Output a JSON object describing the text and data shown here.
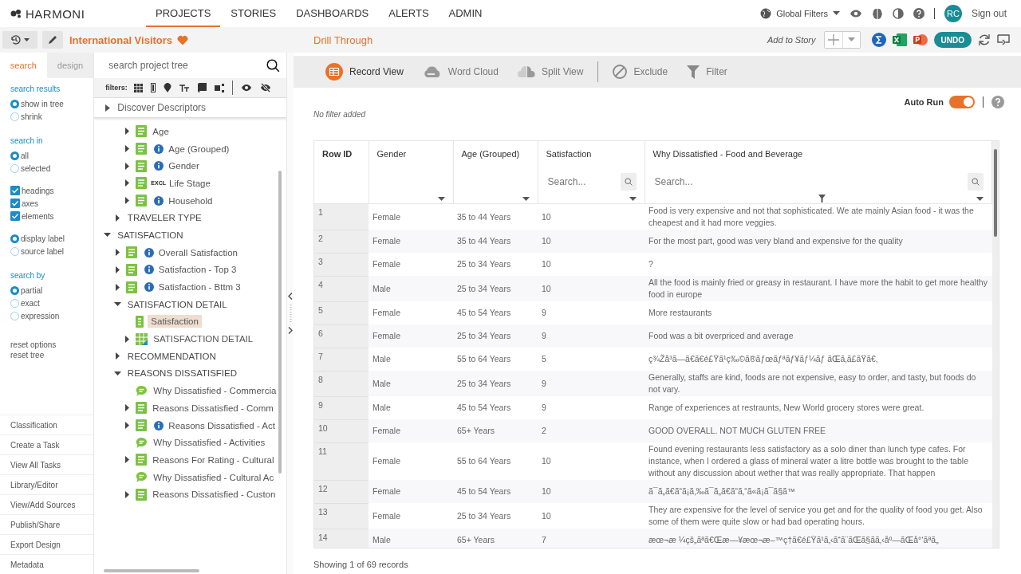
{
  "brand": "HARMONI",
  "nav": [
    {
      "label": "PROJECTS",
      "selected": true
    },
    {
      "label": "STORIES",
      "selected": false
    },
    {
      "label": "DASHBOARDS",
      "selected": false
    },
    {
      "label": "ALERTS",
      "selected": false
    },
    {
      "label": "ADMIN",
      "selected": false
    }
  ],
  "global_filters": "Global Filters",
  "avatar": "RC",
  "sign_out": "Sign out",
  "project_title": "International Visitors",
  "left_tabs": [
    {
      "label": "search",
      "selected": true
    },
    {
      "label": "design",
      "selected": false
    }
  ],
  "tree_search": {
    "placeholder": "search project tree"
  },
  "filters_label": "filters:",
  "options": [
    {
      "kind": "heading",
      "label": "search results"
    },
    {
      "kind": "radio",
      "items": [
        {
          "label": "show in tree",
          "selected": true
        },
        {
          "label": "shrink",
          "selected": false
        }
      ]
    },
    {
      "kind": "heading",
      "label": "search in"
    },
    {
      "kind": "radio",
      "items": [
        {
          "label": "all",
          "selected": true
        },
        {
          "label": "selected",
          "selected": false
        }
      ]
    },
    {
      "kind": "check",
      "items": [
        {
          "label": "headings",
          "checked": true
        },
        {
          "label": "axes",
          "checked": true
        },
        {
          "label": "elements",
          "checked": true
        }
      ]
    },
    {
      "kind": "radio",
      "items": [
        {
          "label": "display label",
          "selected": true
        },
        {
          "label": "source label",
          "selected": false
        }
      ]
    },
    {
      "kind": "heading",
      "label": "search by"
    },
    {
      "kind": "radio",
      "items": [
        {
          "label": "partial",
          "selected": true
        },
        {
          "label": "exact",
          "selected": false
        },
        {
          "label": "expression",
          "selected": false
        }
      ]
    },
    {
      "kind": "links",
      "items": [
        {
          "label": "reset options"
        },
        {
          "label": "reset tree"
        }
      ]
    }
  ],
  "menu": [
    "Classification",
    "Create a Task",
    "View All Tasks",
    "Library/Editor",
    "View/Add Sources",
    "Publish/Share",
    "Export Design",
    "Metadata"
  ],
  "discover": {
    "label": "Discover Descriptors",
    "expanded": false
  },
  "tree": [
    {
      "children": [
        {
          "children": [
            {
              "label": "Age",
              "kind": "variable",
              "expanded": false,
              "selected": false
            },
            {
              "label": "Age (Grouped)",
              "kind": "variable",
              "info": true,
              "expanded": false,
              "selected": false
            },
            {
              "label": "Gender",
              "kind": "variable",
              "info": true,
              "expanded": false,
              "selected": false
            },
            {
              "label": "Life Stage",
              "kind": "variable",
              "badge": "EXCL",
              "expanded": false,
              "selected": false
            },
            {
              "label": "Household",
              "kind": "variable",
              "info": true,
              "expanded": false,
              "selected": false
            }
          ]
        },
        {
          "label": "TRAVELER TYPE",
          "kind": "heading",
          "expanded": false,
          "selected": false
        }
      ]
    },
    {
      "label": "SATISFACTION",
      "kind": "heading",
      "expanded": true,
      "selected": false,
      "children": [
        {
          "label": "Overall Satisfaction",
          "kind": "variable",
          "info": true,
          "expanded": false,
          "selected": false
        },
        {
          "label": "Satisfaction - Top 3",
          "kind": "variable",
          "info": true,
          "expanded": false,
          "selected": false
        },
        {
          "label": "Satisfaction - Bttm 3",
          "kind": "variable",
          "info": true,
          "expanded": false,
          "selected": false
        },
        {
          "label": "SATISFACTION DETAIL",
          "kind": "heading",
          "expanded": true,
          "selected": false,
          "children": [
            {
              "label": "Satisfaction",
              "kind": "numeric",
              "selected": true
            },
            {
              "label": "SATISFACTION DETAIL",
              "kind": "grid",
              "expanded": false,
              "selected": false
            }
          ]
        },
        {
          "label": "RECOMMENDATION",
          "kind": "heading",
          "expanded": false,
          "selected": false
        },
        {
          "label": "REASONS DISSATISFIED",
          "kind": "heading",
          "expanded": true,
          "selected": false,
          "children": [
            {
              "label": "Why Dissatisfied - Commercia",
              "kind": "comment",
              "selected": false
            },
            {
              "label": "Reasons Dissatisfied - Comm",
              "kind": "variable",
              "expanded": false,
              "selected": false
            },
            {
              "label": "Reasons Dissatisfied - Act",
              "kind": "variable",
              "info": true,
              "expanded": false,
              "selected": false
            },
            {
              "label": "Why Dissatisfied - Activities",
              "kind": "comment",
              "selected": false
            },
            {
              "label": "Reasons For Rating - Cultural",
              "kind": "variable",
              "expanded": false,
              "selected": false
            },
            {
              "label": "Why Dissatisfied - Cultural Ac",
              "kind": "comment",
              "selected": false
            },
            {
              "label": "Reasons Dissatisfied - Custon",
              "kind": "variable",
              "expanded": false,
              "selected": false
            }
          ]
        }
      ]
    }
  ],
  "drill_title": "Drill Through",
  "add_to_story": "Add to Story",
  "undo": "UNDO",
  "views": [
    {
      "label": "Record View",
      "kind": "record",
      "selected": true
    },
    {
      "label": "Word Cloud",
      "kind": "cloud",
      "selected": false
    },
    {
      "label": "Split View",
      "kind": "split",
      "selected": false
    },
    {
      "label": "Exclude",
      "kind": "exclude",
      "selected": false
    },
    {
      "label": "Filter",
      "kind": "filter",
      "selected": false
    }
  ],
  "no_filter": "No filter added",
  "auto_run": {
    "label": "Auto Run",
    "on": true
  },
  "table": {
    "columns": [
      {
        "label": "Row ID"
      },
      {
        "label": "Gender",
        "sort": true
      },
      {
        "label": "Age (Grouped)",
        "sort": true
      },
      {
        "label": "Satisfaction",
        "placeholder": "Search...",
        "sort": true
      },
      {
        "label": "Why Dissatisfied - Food and Beverage",
        "placeholder": "Search...",
        "sort": true,
        "filter": true
      }
    ],
    "rows": [
      [
        "1",
        "Female",
        "35 to 44 Years",
        "10",
        "Food is very expensive and not that sophisticated. We ate mainly Asian food - it was the cheapest and it had more veggies."
      ],
      [
        "2",
        "Female",
        "35 to 44 Years",
        "10",
        "For the most part, good was very bland and expensive for the quality"
      ],
      [
        "3",
        "Female",
        "25 to 34 Years",
        "10",
        "?"
      ],
      [
        "4",
        "Male",
        "25 to 34 Years",
        "10",
        "All the food is mainly fried or greasy in restaurant. I have more the habit to get more healthy food in europe"
      ],
      [
        "5",
        "Female",
        "45 to 54 Years",
        "9",
        "More restaurants"
      ],
      [
        "6",
        "Female",
        "25 to 34 Years",
        "9",
        "Food was a bit overpriced and average"
      ],
      [
        "7",
        "Male",
        "55 to 64 Years",
        "5",
        "ç¾Žå³ã—ã€ã€é£Ÿã¹ç‰©ã®ãƒœãƒªãƒ¥ãƒ¼ãƒ ãŒã‚ã£ãŸã€‚"
      ],
      [
        "8",
        "Male",
        "25 to 34 Years",
        "9",
        "Generally, staffs are kind, foods are not expensive, easy to order, and tasty, but foods do not vary."
      ],
      [
        "9",
        "Male",
        "45 to 54 Years",
        "9",
        "Range of experiences at restraunts, New World grocery stores were great."
      ],
      [
        "10",
        "Female",
        "65+ Years",
        "2",
        "GOOD OVERALL. NOT MUCH GLUTEN FREE"
      ],
      [
        "11",
        "Female",
        "55 to 64 Years",
        "10",
        "Found evening restaurants less satisfactory as a solo diner than lunch type cafes. For instance, when I ordered a glass of mineral water a litre bottle was brought to the table without any discussion about wether that was really appropriate. That happen"
      ],
      [
        "12",
        "Female",
        "45 to 54 Years",
        "10",
        "ã¯ã„ã€ã“ã¡ã‚‰ã¯ã„ã€ã“ã‚“ã«ã¡ã¯ã§ã™"
      ],
      [
        "13",
        "Female",
        "25 to 34 Years",
        "10",
        "They are expensive for the level of service you get and for the quality of food you get. Also some of them were quite slow or had bad operating hours."
      ],
      [
        "14",
        "Male",
        "65+ Years",
        "7",
        "æœ¬æ ¼çš„ãªã€Œæ—¥æœ¬æ–™ç†ã€é£Ÿã¹ã‚‹ã“ã¨ãŒã§ãã‚‹åº—ãŒå°‘ãªã„"
      ]
    ]
  },
  "footer": "Showing 1 of 69 records"
}
